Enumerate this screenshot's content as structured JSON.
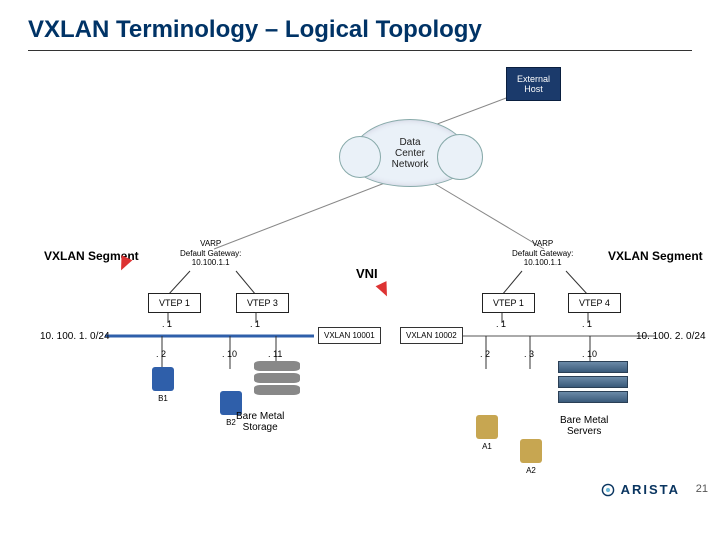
{
  "title": "VXLAN Terminology – Logical Topology",
  "ext_host": "External\nHost",
  "cloud": "Data\nCenter\nNetwork",
  "varp_left": {
    "l1": "VARP",
    "l2": "Default Gateway:",
    "l3": "10.100.1.1"
  },
  "varp_right": {
    "l1": "VARP",
    "l2": "Default Gateway:",
    "l3": "10.100.1.1"
  },
  "left_segment": "VXLAN Segment",
  "right_segment": "VXLAN Segment",
  "vni": "VNI",
  "vtep": {
    "v1": "VTEP 1",
    "v3": "VTEP 3",
    "v1r": "VTEP 1",
    "v4": "VTEP 4"
  },
  "ips": {
    "dot1": ". 1",
    "dot2": ". 2",
    "dot3": ". 3",
    "dot10": ". 10",
    "dot11": ". 11"
  },
  "subnet_left": "10. 100. 1. 0/24",
  "subnet_right": "10. 100. 2. 0/24",
  "vxlan_left": "VXLAN 10001",
  "vxlan_right": "VXLAN 10002",
  "vm": {
    "b1": "B1",
    "b2": "B2",
    "a1": "A1",
    "a2": "A2"
  },
  "bare_storage": "Bare Metal\nStorage",
  "bare_servers": "Bare Metal\nServers",
  "brand": "ARISTA",
  "page": "21"
}
